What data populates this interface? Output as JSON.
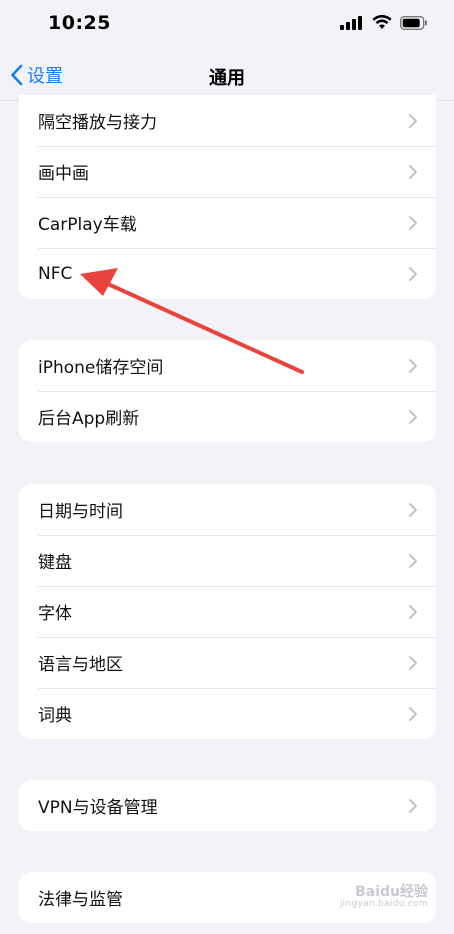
{
  "status_bar": {
    "time": "10:25"
  },
  "nav": {
    "back_label": "设置",
    "title": "通用"
  },
  "groups": [
    {
      "rows": [
        {
          "label": "隔空播放与接力"
        },
        {
          "label": "画中画"
        },
        {
          "label": "CarPlay车载"
        },
        {
          "label": "NFC"
        }
      ]
    },
    {
      "rows": [
        {
          "label": "iPhone储存空间"
        },
        {
          "label": "后台App刷新"
        }
      ]
    },
    {
      "rows": [
        {
          "label": "日期与时间"
        },
        {
          "label": "键盘"
        },
        {
          "label": "字体"
        },
        {
          "label": "语言与地区"
        },
        {
          "label": "词典"
        }
      ]
    },
    {
      "rows": [
        {
          "label": "VPN与设备管理"
        }
      ]
    },
    {
      "rows": [
        {
          "label": "法律与监管"
        }
      ]
    }
  ],
  "watermark": {
    "title": "Baidu经验",
    "sub": "jingyan.baidu.com"
  },
  "colors": {
    "accent": "#1a7cf2",
    "annotation": "#e8433d",
    "background": "#f2f2f7"
  }
}
